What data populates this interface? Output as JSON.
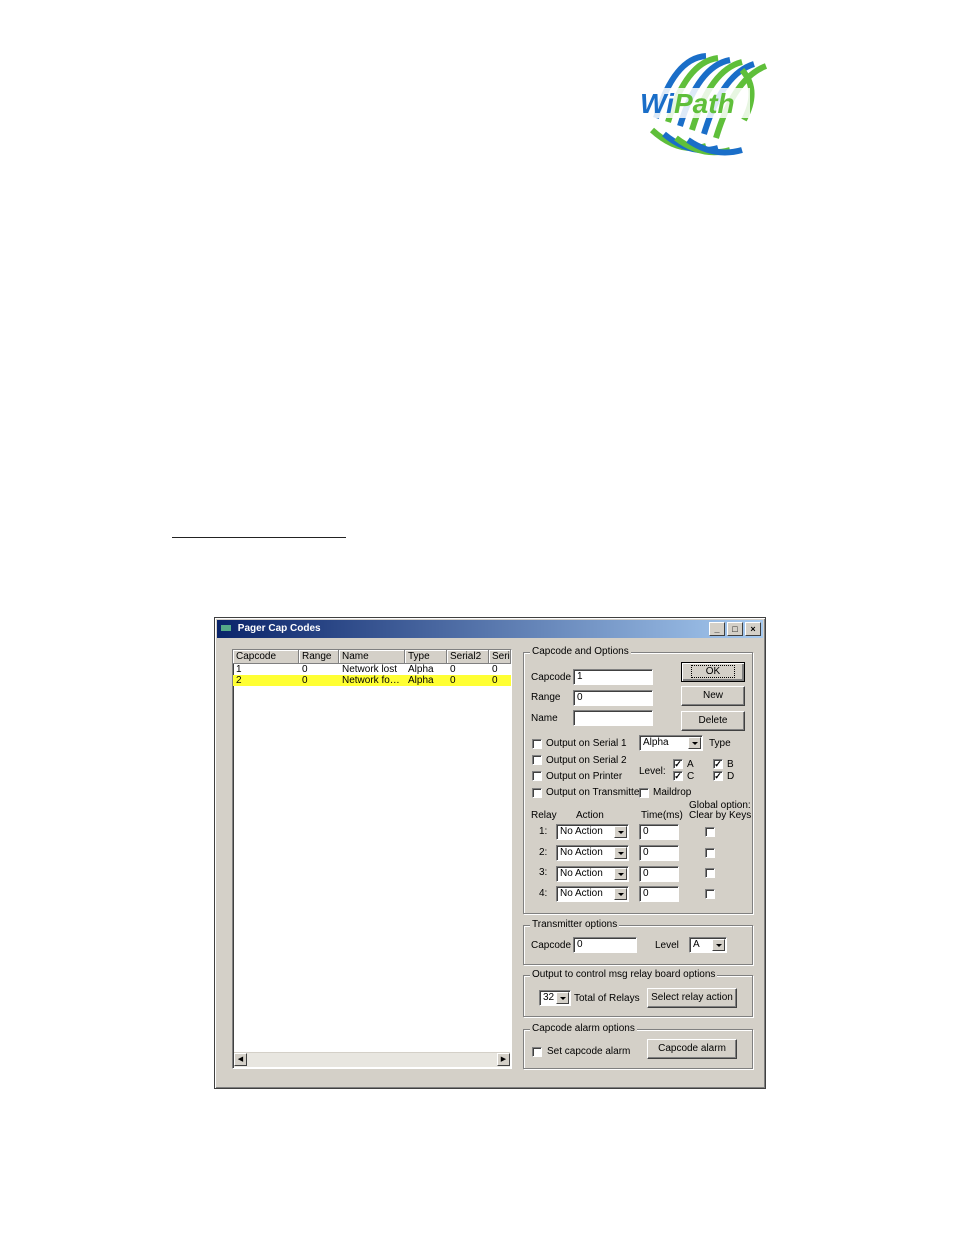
{
  "logo": {
    "text": "WiPath",
    "colors": {
      "green": "#5fbf3a",
      "blue": "#1a6ec8"
    }
  },
  "window": {
    "title": "Pager Cap Codes",
    "controls": {
      "minimize": "_",
      "maximize": "□",
      "close": "×"
    }
  },
  "list": {
    "columns": [
      "Capcode",
      "Range",
      "Name",
      "Type",
      "Serial2",
      "Seri"
    ],
    "rows": [
      {
        "capcode": "1",
        "range": "0",
        "name": "Network lost",
        "type": "Alpha",
        "serial2": "0",
        "seri": "0",
        "selected": false
      },
      {
        "capcode": "2",
        "range": "0",
        "name": "Network fo…",
        "type": "Alpha",
        "serial2": "0",
        "seri": "0",
        "selected": true
      }
    ]
  },
  "options": {
    "group_title": "Capcode and Options",
    "capcode_label": "Capcode",
    "capcode_value": "1",
    "range_label": "Range",
    "range_value": "0",
    "name_label": "Name",
    "name_value": "",
    "ok_label": "OK",
    "new_label": "New",
    "delete_label": "Delete",
    "serial1_label": "Output on Serial 1",
    "serial2_label": "Output on Serial 2",
    "printer_label": "Output on Printer",
    "transmitter_label": "Output on Transmitter",
    "maildrop_label": "Maildrop",
    "type_value": "Alpha",
    "type_label": "Type",
    "level_label": "Level:",
    "levels": {
      "a": "A",
      "b": "B",
      "c": "C",
      "d": "D"
    },
    "relay_header": "Relay",
    "action_header": "Action",
    "time_header": "Time(ms)",
    "global_header_1": "Global option:",
    "global_header_2": "Clear by Keys",
    "relays": [
      {
        "num": "1:",
        "action": "No Action",
        "time": "0"
      },
      {
        "num": "2:",
        "action": "No Action",
        "time": "0"
      },
      {
        "num": "3:",
        "action": "No Action",
        "time": "0"
      },
      {
        "num": "4:",
        "action": "No Action",
        "time": "0"
      }
    ]
  },
  "transmitter": {
    "group_title": "Transmitter options",
    "capcode_label": "Capcode",
    "capcode_value": "0",
    "level_label": "Level",
    "level_value": "A"
  },
  "relay_board": {
    "group_title": "Output to control msg relay board options",
    "total_value": "32",
    "total_label": "Total of Relays",
    "select_button": "Select relay action"
  },
  "alarm": {
    "group_title": "Capcode alarm options",
    "set_label": "Set capcode alarm",
    "alarm_button": "Capcode alarm"
  }
}
